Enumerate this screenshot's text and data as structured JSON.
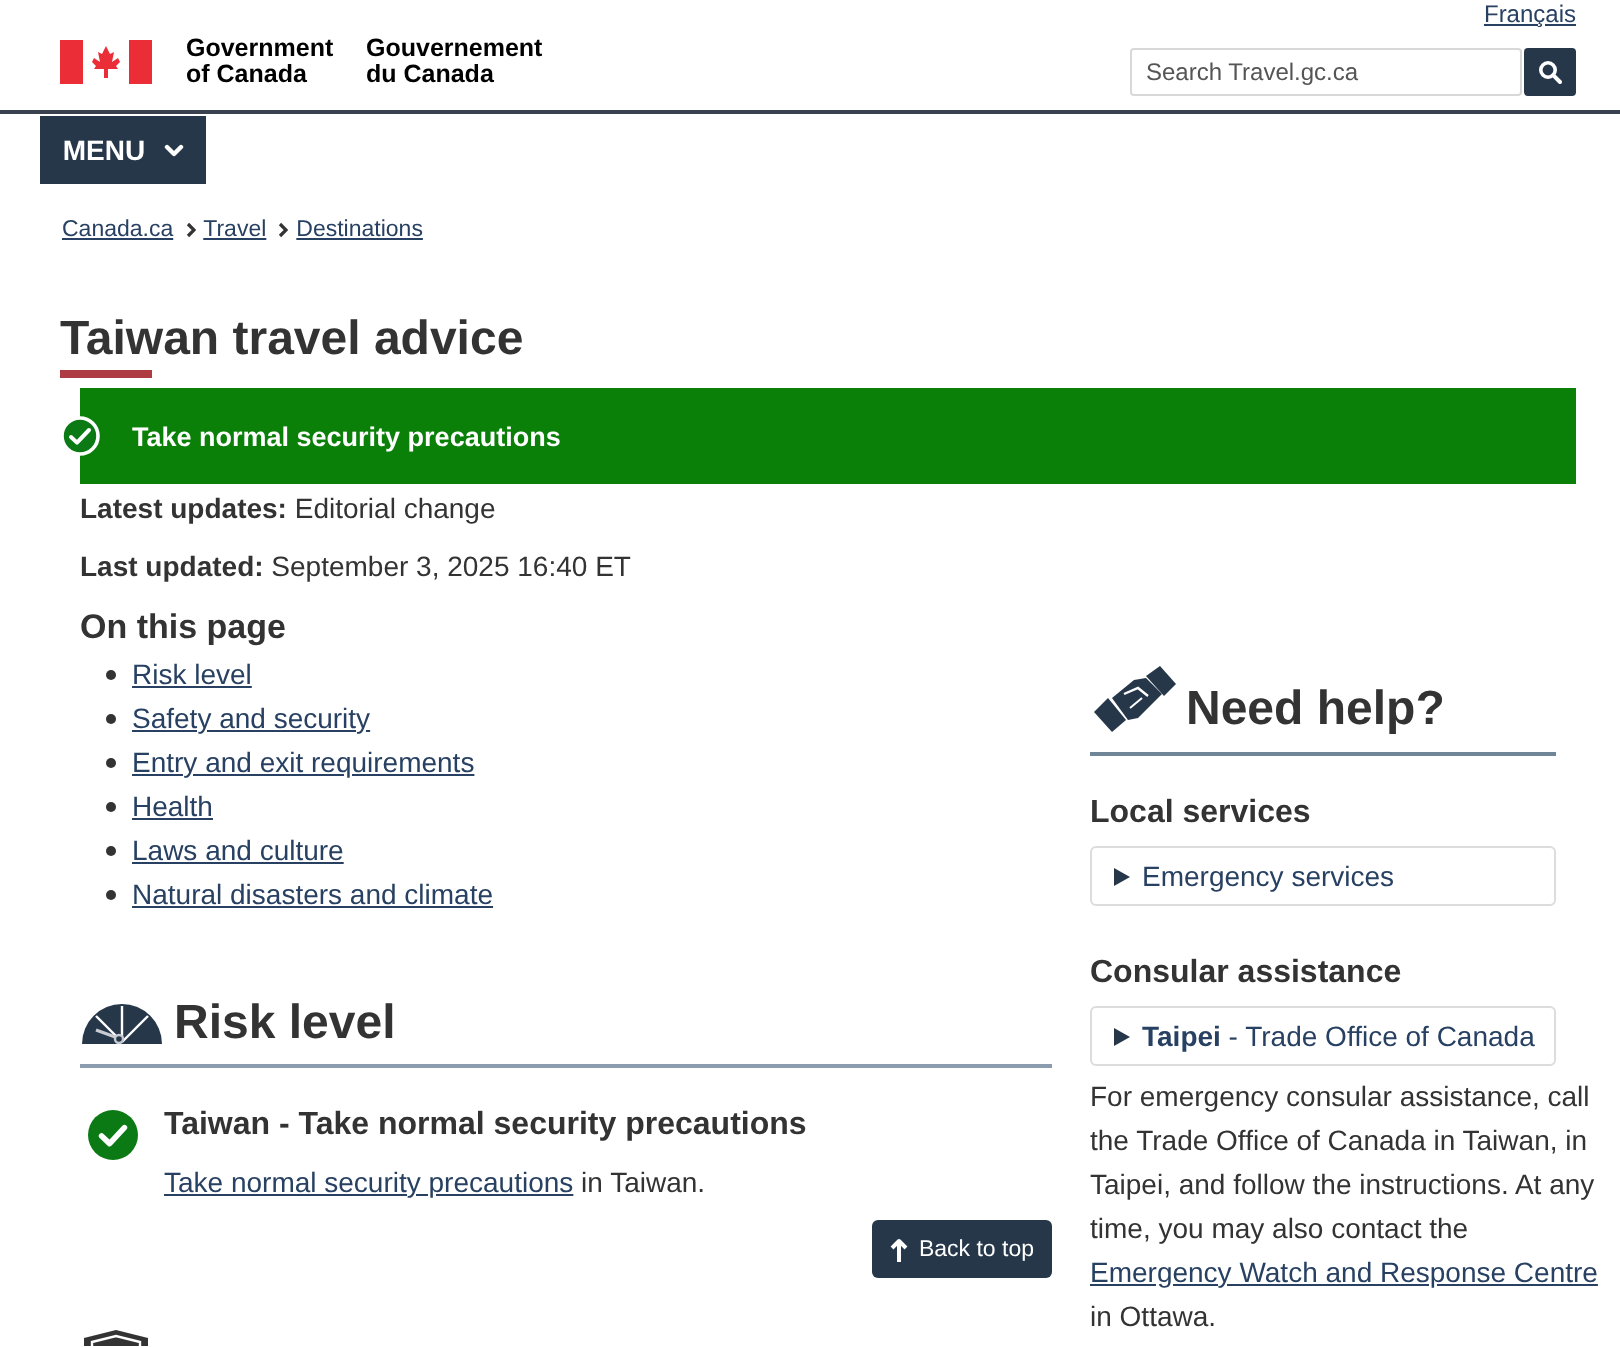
{
  "header": {
    "language_link": "Français",
    "wordmark": {
      "english": "Government of Canada",
      "french": "Gouvernement du Canada"
    },
    "search": {
      "placeholder": "Search Travel.gc.ca"
    }
  },
  "menu": {
    "label": "MENU",
    "expanded": false
  },
  "breadcrumb": [
    "Canada.ca",
    "Travel",
    "Destinations"
  ],
  "title": "Taiwan travel advice",
  "advisory_banner": {
    "text": "Take normal security precautions"
  },
  "updates": [
    "**Latest updates:** Editorial change",
    "**Last updated:** September 3, 2025 16:40 ET"
  ],
  "on_this_page": {
    "heading": "On this page",
    "links": [
      "Risk level",
      "Safety and security",
      "Entry and exit requirements",
      "Health",
      "Laws and culture",
      "Natural disasters and climate"
    ]
  },
  "risk_level": {
    "heading": "Risk level",
    "advisory": {
      "title": "Taiwan - Take normal security precautions",
      "link": "Take normal security precautions",
      "after": "in Taiwan."
    },
    "back_to_top": "Back to top"
  },
  "need_help": {
    "heading": "Need help?",
    "sections": [
      {
        "heading": "Local services",
        "entries": [
          {
            "label": "Emergency services",
            "expanded": false
          }
        ]
      },
      {
        "heading": "Consular assistance",
        "entries": [
          {
            "label": "**Taipei** - Trade Office of Canada",
            "expanded": false
          }
        ],
        "note": {
          "before": "For emergency consular assistance, call the Trade Office of Canada in Taiwan, in Taipei, and follow the instructions. At any time, you may also contact the",
          "link": "Emergency Watch and Response Centre",
          "after": "in Ottawa."
        }
      }
    ]
  }
}
